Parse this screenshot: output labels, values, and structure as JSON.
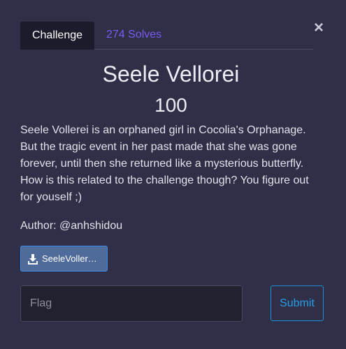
{
  "modal": {
    "close_symbol": "×",
    "tabs": {
      "challenge_label": "Challenge",
      "solves_label": "274 Solves"
    },
    "challenge": {
      "name": "Seele Vellorei",
      "points": "100",
      "description": "Seele Vollerei is an orphaned girl in Cocolia's Orphanage. But the tragic event in her past made that she was gone forever, until then she returned like a mysterious butterfly. How is this related to the challenge though? You figure out for youself ;)",
      "author": "Author: @anhshidou"
    },
    "file": {
      "icon": "download-icon",
      "label": "SeeleVoller…"
    },
    "flag": {
      "placeholder": "Flag",
      "value": ""
    },
    "submit_label": "Submit"
  },
  "colors": {
    "background": "#2f2f48",
    "active_tab": "#1b1b2c",
    "solves_link": "#7b5cf0",
    "file_button": "#4f6b99",
    "submit_border": "#1f8fd6"
  }
}
